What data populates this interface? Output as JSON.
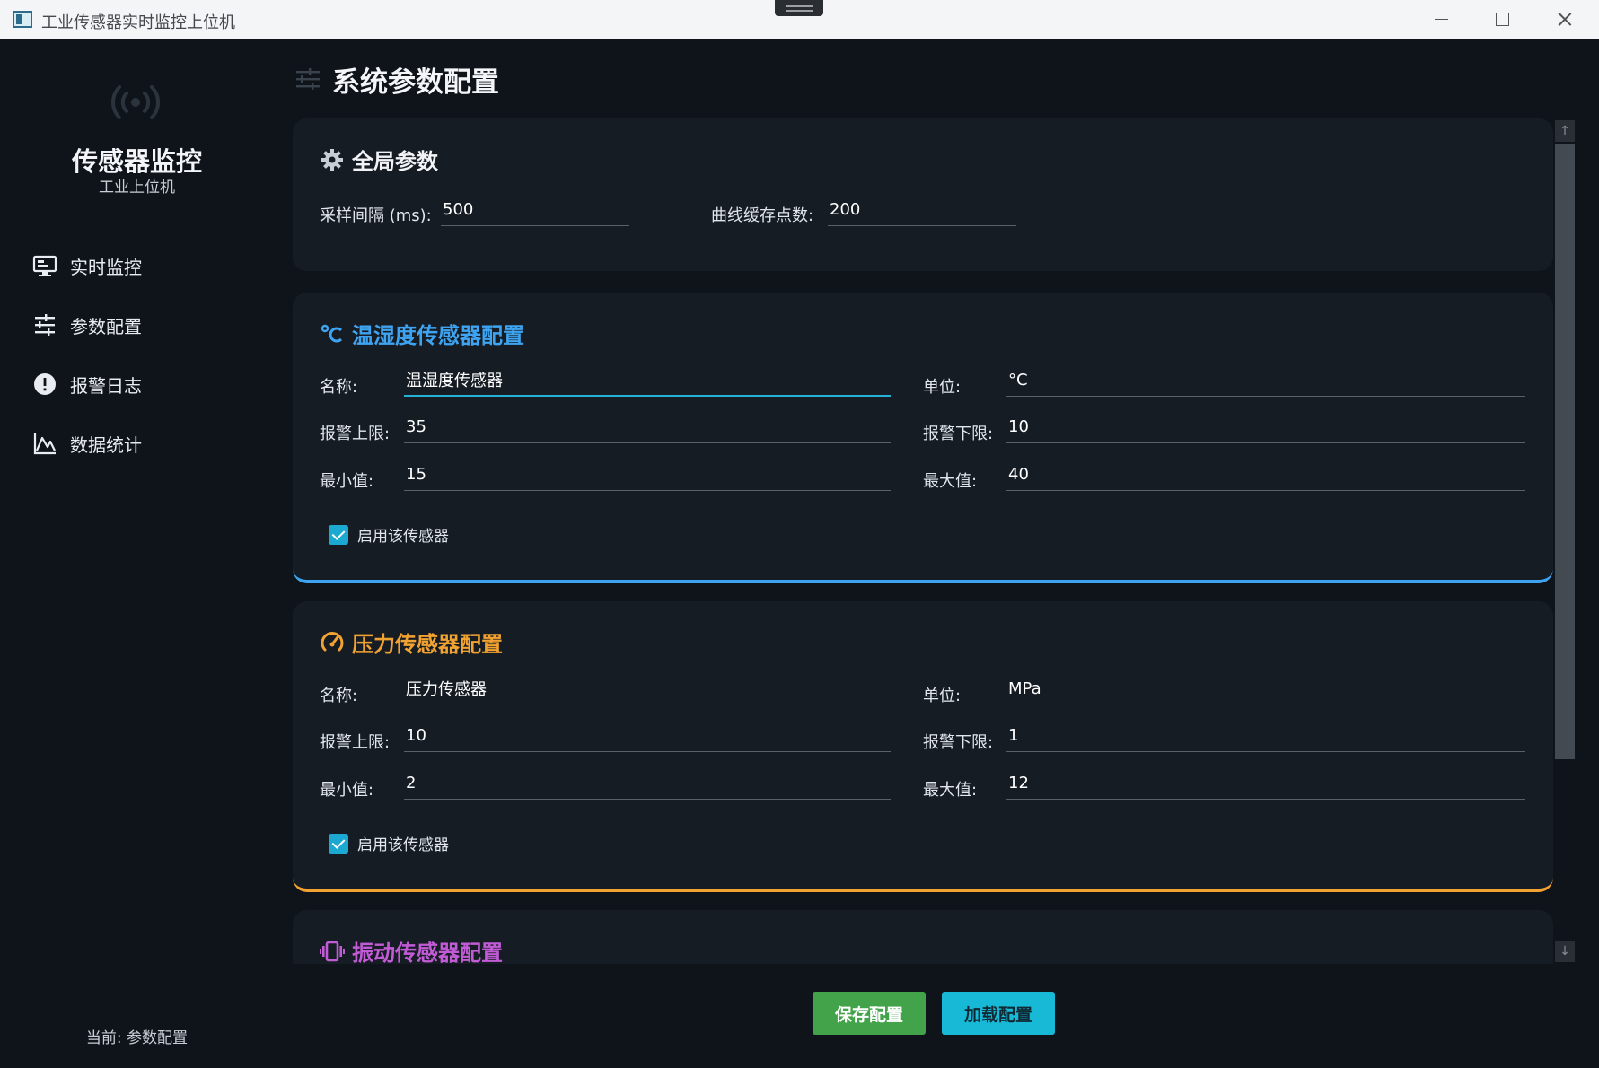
{
  "window": {
    "title": "工业传感器实时监控上位机"
  },
  "sidebar": {
    "brand_title": "传感器监控",
    "brand_subtitle": "工业上位机",
    "items": [
      {
        "label": "实时监控",
        "icon": "monitor-icon"
      },
      {
        "label": "参数配置",
        "icon": "sliders-icon"
      },
      {
        "label": "报警日志",
        "icon": "alert-icon"
      },
      {
        "label": "数据统计",
        "icon": "chart-icon"
      }
    ],
    "current": "当前: 参数配置"
  },
  "page": {
    "title": "系统参数配置"
  },
  "global": {
    "title": "全局参数",
    "sample_label": "采样间隔 (ms):",
    "sample_value": "500",
    "buffer_label": "曲线缓存点数:",
    "buffer_value": "200"
  },
  "temp": {
    "title": "温湿度传感器配置",
    "accent": "#3ea3f0",
    "name_label": "名称:",
    "name_value": "温湿度传感器",
    "unit_label": "单位:",
    "unit_value": "°C",
    "high_label": "报警上限:",
    "high_value": "35",
    "low_label": "报警下限:",
    "low_value": "10",
    "min_label": "最小值:",
    "min_value": "15",
    "max_label": "最大值:",
    "max_value": "40",
    "enable_label": "启用该传感器",
    "enabled": true
  },
  "pressure": {
    "title": "压力传感器配置",
    "accent": "#f1a230",
    "name_label": "名称:",
    "name_value": "压力传感器",
    "unit_label": "单位:",
    "unit_value": "MPa",
    "high_label": "报警上限:",
    "high_value": "10",
    "low_label": "报警下限:",
    "low_value": "1",
    "min_label": "最小值:",
    "min_value": "2",
    "max_label": "最大值:",
    "max_value": "12",
    "enable_label": "启用该传感器",
    "enabled": true
  },
  "vibration": {
    "title": "振动传感器配置",
    "accent": "#c25bd6"
  },
  "buttons": {
    "save": "保存配置",
    "load": "加载配置"
  }
}
